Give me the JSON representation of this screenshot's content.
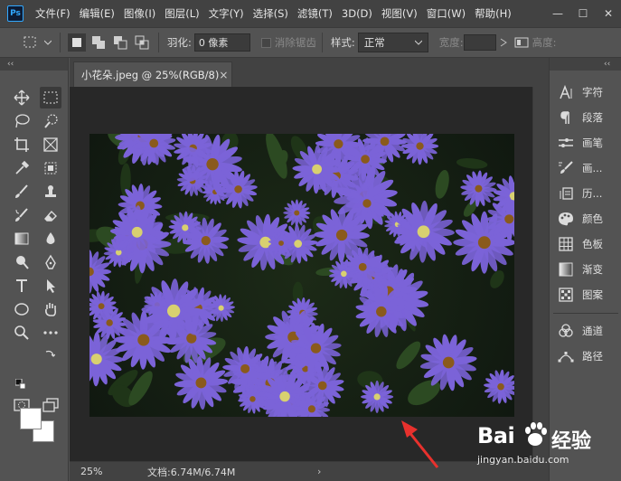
{
  "app": {
    "logo": "Ps",
    "menu": [
      "文件(F)",
      "编辑(E)",
      "图像(I)",
      "图层(L)",
      "文字(Y)",
      "选择(S)",
      "滤镜(T)",
      "3D(D)",
      "视图(V)",
      "窗口(W)",
      "帮助(H)"
    ],
    "window_controls": [
      "—",
      "☐",
      "✕"
    ]
  },
  "options": {
    "feather_label": "羽化:",
    "feather_value": "0 像素",
    "antialias_label": "消除锯齿",
    "style_label": "样式:",
    "style_value": "正常",
    "width_label": "宽度:",
    "height_label": "高度:"
  },
  "document": {
    "tab_title": "小花朵.jpeg @ 25%(RGB/8)",
    "tab_close": "×",
    "zoom": "25%",
    "doc_info": "文档:6.74M/6.74M",
    "status_arrow": "›"
  },
  "panels": {
    "collapse": "‹‹",
    "group1": [
      "字符",
      "段落",
      "画笔",
      "画...",
      "历...",
      "颜色",
      "色板",
      "渐变",
      "图案"
    ],
    "group2": [
      "通道",
      "路径"
    ]
  },
  "colors": {
    "accent": "#31a8ff",
    "arrow": "#e8312d",
    "flower": "#7b63d8",
    "flower_center": "#8a5a1c"
  },
  "watermark": {
    "brand": "Bai",
    "brand2": "经验",
    "url": "jingyan.baidu.com"
  }
}
